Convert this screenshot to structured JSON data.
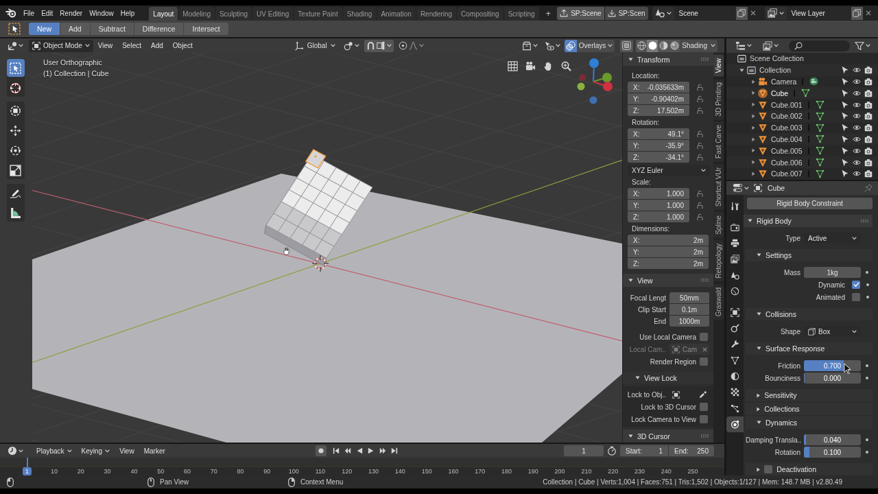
{
  "top_bar": {
    "menus": [
      "File",
      "Edit",
      "Render",
      "Window",
      "Help"
    ],
    "workspaces": [
      {
        "label": "Layout",
        "selected": true
      },
      {
        "label": "Modeling",
        "selected": false
      },
      {
        "label": "Sculpting",
        "selected": false
      },
      {
        "label": "UV Editing",
        "selected": false
      },
      {
        "label": "Texture Paint",
        "selected": false
      },
      {
        "label": "Shading",
        "selected": false
      },
      {
        "label": "Animation",
        "selected": false
      },
      {
        "label": "Rendering",
        "selected": false
      },
      {
        "label": "Compositing",
        "selected": false
      },
      {
        "label": "Scripting",
        "selected": false
      }
    ],
    "add_workspace": "+",
    "scene_buttons": [
      {
        "kind": "upload",
        "label": "SP:Scene"
      },
      {
        "kind": "download",
        "label": "SP:Scen"
      }
    ],
    "scene": "Scene",
    "view_layer": "View Layer"
  },
  "tool_header": {
    "modes": [
      {
        "label": "New",
        "selected": true
      },
      {
        "label": "Add",
        "selected": false
      },
      {
        "label": "Subtract",
        "selected": false
      },
      {
        "label": "Difference",
        "selected": false
      },
      {
        "label": "Intersect",
        "selected": false
      }
    ]
  },
  "viewport": {
    "mode": "Object Mode",
    "menus": [
      "View",
      "Select",
      "Add",
      "Object"
    ],
    "orientation": "Global",
    "overlays_enabled": true,
    "overlays": "Overlays",
    "shading_modes": [
      {
        "kind": "wireframe",
        "selected": false
      },
      {
        "kind": "solid",
        "selected": true
      },
      {
        "kind": "material",
        "selected": false
      },
      {
        "kind": "rendered",
        "selected": false
      }
    ],
    "shading": "Shading",
    "view_name": "User Orthographic",
    "object_info": "(1) Collection | Cube",
    "tools": [
      {
        "kind": "select_box",
        "selected": true
      },
      {
        "kind": "cursor",
        "selected": false
      },
      {
        "kind": "transform",
        "selected": false
      },
      {
        "kind": "move",
        "selected": false
      },
      {
        "kind": "rotate",
        "selected": false
      },
      {
        "kind": "scale",
        "selected": false
      },
      {
        "kind": "annotate",
        "selected": false
      },
      {
        "kind": "measure",
        "selected": false
      }
    ]
  },
  "sidebar": {
    "tabs": [
      {
        "label": "View",
        "selected": true
      },
      {
        "label": "3D Printing",
        "selected": false
      },
      {
        "label": "Fast Carve",
        "selected": false
      },
      {
        "label": "Shortcut VUr",
        "selected": false
      },
      {
        "label": "Spline",
        "selected": false
      },
      {
        "label": "Retopology",
        "selected": false
      },
      {
        "label": "Graswald",
        "selected": false
      }
    ],
    "transform": {
      "title": "Transform",
      "expanded": true,
      "location": {
        "label": "Location:",
        "fields": [
          {
            "axis": "X:",
            "value": "-0.035633m"
          },
          {
            "axis": "Y:",
            "value": "-0.90402m"
          },
          {
            "axis": "Z:",
            "value": "17.502m"
          }
        ]
      },
      "rotation": {
        "label": "Rotation:",
        "fields": [
          {
            "axis": "X:",
            "value": "49.1°"
          },
          {
            "axis": "Y:",
            "value": "-35.9°"
          },
          {
            "axis": "Z:",
            "value": "-34.1°"
          }
        ]
      },
      "rotation_mode": "XYZ Euler",
      "scale": {
        "label": "Scale:",
        "fields": [
          {
            "axis": "X:",
            "value": "1.000"
          },
          {
            "axis": "Y:",
            "value": "1.000"
          },
          {
            "axis": "Z:",
            "value": "1.000"
          }
        ]
      },
      "dimensions": {
        "label": "Dimensions:",
        "fields": [
          {
            "axis": "X:",
            "value": "2m"
          },
          {
            "axis": "Y:",
            "value": "2m"
          },
          {
            "axis": "Z:",
            "value": "2m"
          }
        ]
      }
    },
    "view": {
      "title": "View",
      "expanded": true,
      "fields": [
        {
          "label": "Focal Lengt",
          "value": "50mm"
        },
        {
          "label": "Clip Start",
          "value": "0.1m"
        },
        {
          "label": "End",
          "value": "1000m"
        }
      ],
      "options": [
        {
          "kind": "checkbox",
          "label": "Use Local Camera",
          "checked": false,
          "disabled": false
        },
        {
          "kind": "object",
          "label": "Local Cam..",
          "value": "Cam",
          "disabled": true
        },
        {
          "kind": "checkbox",
          "label": "Render Region",
          "checked": false,
          "disabled": false
        }
      ]
    },
    "view_lock": {
      "title": "View Lock",
      "expanded": true,
      "object_label": "Lock to Obj..",
      "options": [
        {
          "label": "Lock to 3D Cursor",
          "checked": false
        },
        {
          "label": "Lock Camera to View",
          "checked": false
        }
      ]
    },
    "cursor": {
      "title": "3D Cursor",
      "expanded": true
    }
  },
  "outliner": {
    "root": "Scene Collection",
    "collections": [
      {
        "name": "Collection",
        "expanded": true,
        "children": [
          {
            "name": "Camera",
            "kind": "camera",
            "selected": false
          },
          {
            "name": "Cube",
            "kind": "mesh",
            "selected": true
          },
          {
            "name": "Cube.001",
            "kind": "mesh",
            "selected": false
          },
          {
            "name": "Cube.002",
            "kind": "mesh",
            "selected": false
          },
          {
            "name": "Cube.003",
            "kind": "mesh",
            "selected": false
          },
          {
            "name": "Cube.004",
            "kind": "mesh",
            "selected": false
          },
          {
            "name": "Cube.005",
            "kind": "mesh",
            "selected": false
          },
          {
            "name": "Cube.006",
            "kind": "mesh",
            "selected": false
          },
          {
            "name": "Cube.007",
            "kind": "mesh",
            "selected": false
          }
        ]
      }
    ]
  },
  "properties": {
    "object_name": "Cube",
    "tabs": [
      {
        "kind": "tool",
        "selected": false
      },
      {
        "kind": "render",
        "selected": false
      },
      {
        "kind": "output",
        "selected": false
      },
      {
        "kind": "view_layer",
        "selected": false
      },
      {
        "kind": "scene",
        "selected": false
      },
      {
        "kind": "world",
        "selected": false
      },
      {
        "kind": "object",
        "selected": false
      },
      {
        "kind": "constraints",
        "selected": false
      },
      {
        "kind": "modifiers",
        "selected": false
      },
      {
        "kind": "data",
        "selected": false
      },
      {
        "kind": "material",
        "selected": false
      },
      {
        "kind": "texture",
        "selected": false
      },
      {
        "kind": "particles",
        "selected": false
      },
      {
        "kind": "physics",
        "selected": true
      }
    ],
    "constraint_button": "Rigid Body Constraint",
    "rows": [
      {
        "kind": "panel",
        "title": "Rigid Body",
        "expanded": true
      },
      {
        "kind": "dropdown",
        "label": "Type",
        "value": "Active"
      },
      {
        "kind": "subpanel",
        "title": "Settings",
        "expanded": true
      },
      {
        "kind": "number",
        "label": "Mass",
        "value": "1kg"
      },
      {
        "kind": "checkbox",
        "label": "Dynamic",
        "checked": true
      },
      {
        "kind": "checkbox",
        "label": "Animated",
        "checked": false
      },
      {
        "kind": "subpanel",
        "title": "Collisions",
        "expanded": true
      },
      {
        "kind": "icon_dropdown",
        "label": "Shape",
        "value": "Box"
      },
      {
        "kind": "subpanel",
        "title": "Surface Response",
        "expanded": true
      },
      {
        "kind": "slider",
        "label": "Friction",
        "value": "0.700",
        "level": 0.7
      },
      {
        "kind": "slider",
        "label": "Bounciness",
        "value": "0.000",
        "level": 0
      },
      {
        "kind": "subpanel",
        "title": "Sensitivity",
        "expanded": false
      },
      {
        "kind": "subpanel",
        "title": "Collections",
        "expanded": false
      },
      {
        "kind": "subpanel",
        "title": "Dynamics",
        "expanded": true
      },
      {
        "kind": "slider",
        "label": "Damping Transla..",
        "value": "0.040",
        "level": 0.04
      },
      {
        "kind": "slider",
        "label": "Rotation",
        "value": "0.100",
        "level": 0.1
      },
      {
        "kind": "checkbox_subpanel",
        "title": "Deactivation",
        "expanded": false,
        "checked": false
      }
    ]
  },
  "timeline": {
    "menus": [
      {
        "label": "Playback",
        "dropdown": true
      },
      {
        "label": "Keying",
        "dropdown": true
      },
      {
        "label": "View",
        "dropdown": false
      },
      {
        "label": "Marker",
        "dropdown": false
      }
    ],
    "current_frame": "1",
    "start_label": "Start:",
    "start": "1",
    "end_label": "End:",
    "end": "250",
    "playhead": "1",
    "ruler": [
      "10",
      "20",
      "30",
      "40",
      "50",
      "60",
      "70",
      "80",
      "90",
      "100",
      "110",
      "120",
      "130",
      "140",
      "150",
      "160",
      "170",
      "180",
      "190",
      "200",
      "210",
      "220",
      "230",
      "240",
      "250"
    ]
  },
  "status_bar": {
    "hints": [
      {
        "kind": "left"
      },
      {
        "kind": "middle",
        "label": "Pan View"
      },
      {
        "kind": "right",
        "label": "Context Menu"
      }
    ],
    "stats": "Collection | Cube | Verts:1,004 | Faces:751 | Tris:1,502 | Objects:1/127 | Mem: 148.7 MB | v2.80.49"
  }
}
